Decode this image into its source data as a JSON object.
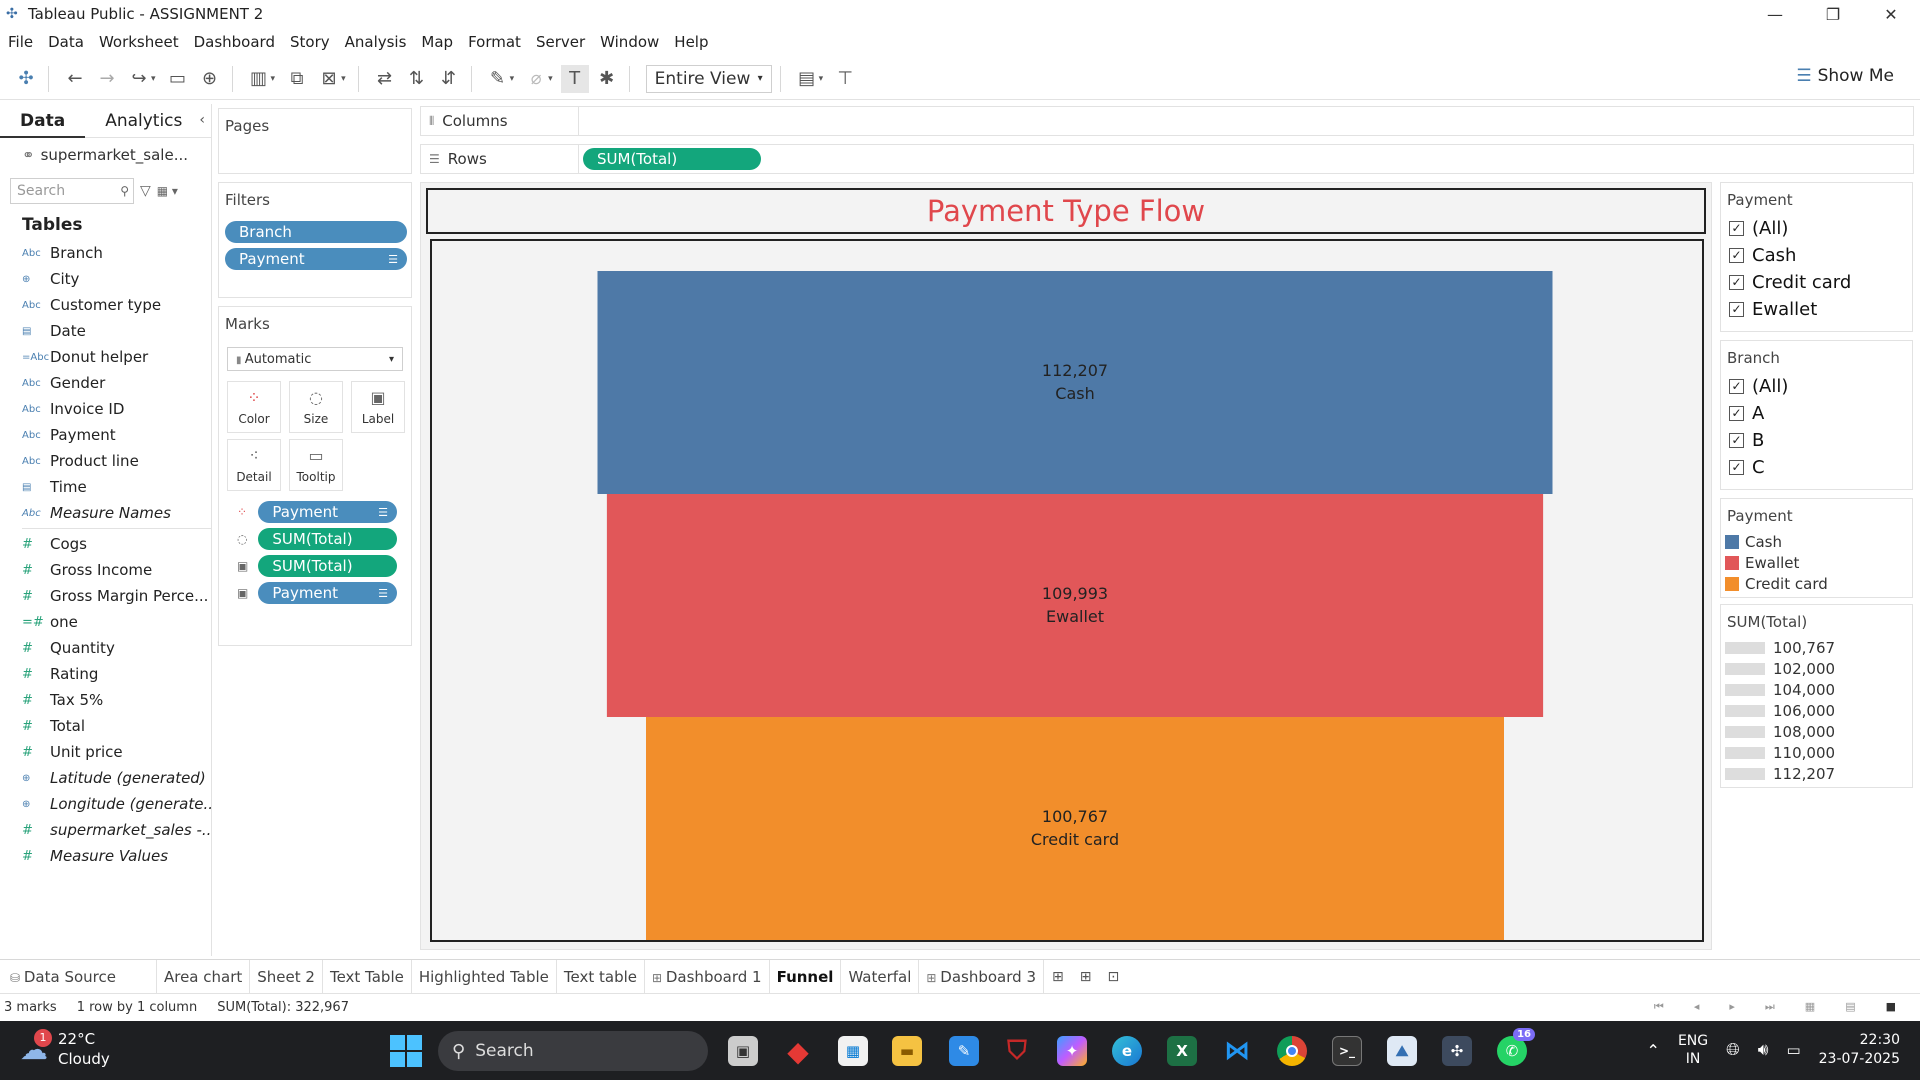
{
  "window": {
    "title": "Tableau Public - ASSIGNMENT 2",
    "minimize": "—",
    "maximize": "❐",
    "close": "✕"
  },
  "menu": [
    "File",
    "Data",
    "Worksheet",
    "Dashboard",
    "Story",
    "Analysis",
    "Map",
    "Format",
    "Server",
    "Window",
    "Help"
  ],
  "toolbar": {
    "view_mode": "Entire View",
    "show_me": "Show Me"
  },
  "data_pane": {
    "tabs": [
      "Data",
      "Analytics"
    ],
    "datasource": "supermarket_sale...",
    "search_placeholder": "Search",
    "tables_heading": "Tables",
    "dimensions": [
      {
        "type": "Abc",
        "name": "Branch"
      },
      {
        "type": "globe",
        "name": "City"
      },
      {
        "type": "Abc",
        "name": "Customer type"
      },
      {
        "type": "date",
        "name": "Date"
      },
      {
        "type": "=Abc",
        "name": "Donut helper"
      },
      {
        "type": "Abc",
        "name": "Gender"
      },
      {
        "type": "Abc",
        "name": "Invoice ID"
      },
      {
        "type": "Abc",
        "name": "Payment"
      },
      {
        "type": "Abc",
        "name": "Product line"
      },
      {
        "type": "date",
        "name": "Time"
      },
      {
        "type": "Abc",
        "name": "Measure Names",
        "italic": true
      }
    ],
    "measures": [
      {
        "type": "#",
        "name": "Cogs"
      },
      {
        "type": "#",
        "name": "Gross Income"
      },
      {
        "type": "#",
        "name": "Gross Margin Perce..."
      },
      {
        "type": "=#",
        "name": "one"
      },
      {
        "type": "#",
        "name": "Quantity"
      },
      {
        "type": "#",
        "name": "Rating"
      },
      {
        "type": "#",
        "name": "Tax 5%"
      },
      {
        "type": "#",
        "name": "Total"
      },
      {
        "type": "#",
        "name": "Unit price"
      },
      {
        "type": "globe",
        "name": "Latitude (generated)",
        "italic": true
      },
      {
        "type": "globe",
        "name": "Longitude (generate...",
        "italic": true
      },
      {
        "type": "#",
        "name": "supermarket_sales -...",
        "italic": true
      },
      {
        "type": "#",
        "name": "Measure Values",
        "italic": true
      }
    ]
  },
  "pages_card": {
    "title": "Pages"
  },
  "filters_card": {
    "title": "Filters",
    "pills": [
      "Branch",
      "Payment"
    ]
  },
  "marks_card": {
    "title": "Marks",
    "type": "Automatic",
    "buttons": [
      "Color",
      "Size",
      "Label",
      "Detail",
      "Tooltip"
    ],
    "rows": [
      {
        "pill": "Payment",
        "color": "blue"
      },
      {
        "pill": "SUM(Total)",
        "color": "green"
      },
      {
        "pill": "SUM(Total)",
        "color": "green"
      },
      {
        "pill": "Payment",
        "color": "blue"
      }
    ]
  },
  "shelves": {
    "columns_label": "Columns",
    "rows_label": "Rows",
    "rows_pill": "SUM(Total)"
  },
  "viz": {
    "title": "Payment Type Flow",
    "title_color": "#e0474c"
  },
  "chart_data": {
    "type": "bar",
    "title": "Payment Type Flow",
    "categories": [
      "Cash",
      "Ewallet",
      "Credit card"
    ],
    "values": [
      112207,
      109993,
      100767
    ],
    "value_labels": [
      "112,207",
      "109,993",
      "100,767"
    ],
    "colors": [
      "#4e79a7",
      "#e15759",
      "#f28e2b"
    ],
    "orientation": "funnel"
  },
  "legends": {
    "payment_filter": {
      "title": "Payment",
      "items": [
        "(All)",
        "Cash",
        "Credit card",
        "Ewallet"
      ]
    },
    "branch_filter": {
      "title": "Branch",
      "items": [
        "(All)",
        "A",
        "B",
        "C"
      ]
    },
    "payment_color": {
      "title": "Payment",
      "items": [
        {
          "label": "Cash",
          "color": "#4e79a7"
        },
        {
          "label": "Ewallet",
          "color": "#e15759"
        },
        {
          "label": "Credit card",
          "color": "#f28e2b"
        }
      ]
    },
    "size": {
      "title": "SUM(Total)",
      "items": [
        "100,767",
        "102,000",
        "104,000",
        "106,000",
        "108,000",
        "110,000",
        "112,207"
      ]
    }
  },
  "sheet_tabs": [
    {
      "label": "Data Source",
      "icon": "db"
    },
    {
      "label": "Area chart"
    },
    {
      "label": "Sheet 2"
    },
    {
      "label": "Text Table"
    },
    {
      "label": "Highlighted Table"
    },
    {
      "label": "Text table"
    },
    {
      "label": "Dashboard 1",
      "icon": "dash"
    },
    {
      "label": "Funnel",
      "active": true
    },
    {
      "label": "Waterfal"
    },
    {
      "label": "Dashboard 3",
      "icon": "dash"
    }
  ],
  "status": {
    "marks": "3 marks",
    "dims": "1 row by 1 column",
    "sum": "SUM(Total): 322,967"
  },
  "taskbar": {
    "weather_temp": "22°C",
    "weather_desc": "Cloudy",
    "weather_badge": "1",
    "search": "Search",
    "whatsapp_badge": "16",
    "lang1": "ENG",
    "lang2": "IN",
    "time": "22:30",
    "date": "23-07-2025"
  }
}
